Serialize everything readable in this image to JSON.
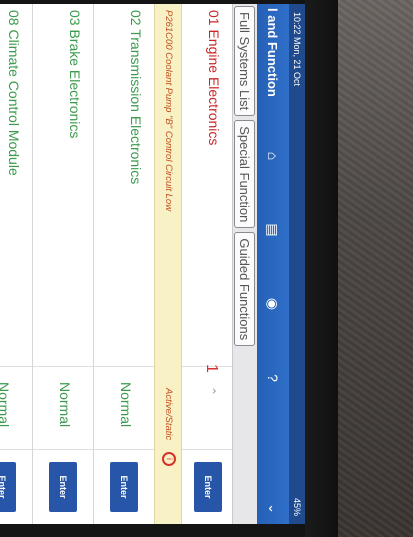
{
  "status_bar": {
    "time_date": "10:22 Mon, 21 Oct",
    "battery": "45%"
  },
  "nav": {
    "title": "l and Function",
    "icons": [
      "home-icon",
      "document-icon",
      "person-icon",
      "help-icon"
    ],
    "chevron": "chevron-down-icon"
  },
  "tabs": [
    "Full Systems List",
    "Special Function",
    "Guided Functions"
  ],
  "modules": [
    {
      "name": "01 Engine Electronics",
      "faults": "1",
      "enter": "Enter",
      "color": "#c6282a"
    },
    {
      "name": "02 Transmission Electronics",
      "status": "Normal",
      "enter": "Enter"
    },
    {
      "name": "03 Brake Electronics",
      "status": "Normal",
      "enter": "Enter"
    },
    {
      "name": "08 Climate Control Module",
      "status": "Normal",
      "enter": "Enter"
    }
  ],
  "dtc": {
    "code_text": "P261C00 Coolant Pump \"B\" Control Circuit Low",
    "status": "Active/Static"
  },
  "colors": {
    "accent": "#2f6fc9",
    "normal": "#3b9a4b",
    "fault": "#c6282a",
    "dtc_bg": "#f8f1c5"
  }
}
